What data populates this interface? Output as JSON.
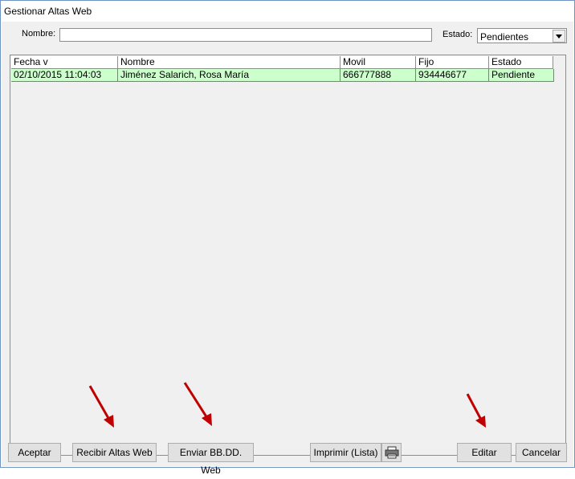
{
  "window": {
    "title": "Gestionar Altas Web"
  },
  "filters": {
    "nombre_label": "Nombre:",
    "nombre_value": "",
    "estado_label": "Estado:",
    "estado_value": "Pendientes"
  },
  "table": {
    "columns": [
      "Fecha v",
      "Nombre",
      "Movil",
      "Fijo",
      "Estado"
    ],
    "rows": [
      [
        "02/10/2015 11:04:03",
        "Jiménez Salarich, Rosa María",
        "666777888",
        "934446677",
        "Pendiente"
      ]
    ]
  },
  "buttons": {
    "aceptar": "Aceptar",
    "recibir": "Recibir Altas Web",
    "enviar": "Enviar BB.DD. Web",
    "imprimir": "Imprimir (Lista)",
    "editar": "Editar",
    "cancelar": "Cancelar"
  },
  "colors": {
    "row_highlight": "#ccffcc",
    "annotation_arrow": "#c00000",
    "window_border": "#6f94c4"
  },
  "icons": {
    "print": "printer-icon",
    "dropdown": "chevron-down-icon"
  }
}
